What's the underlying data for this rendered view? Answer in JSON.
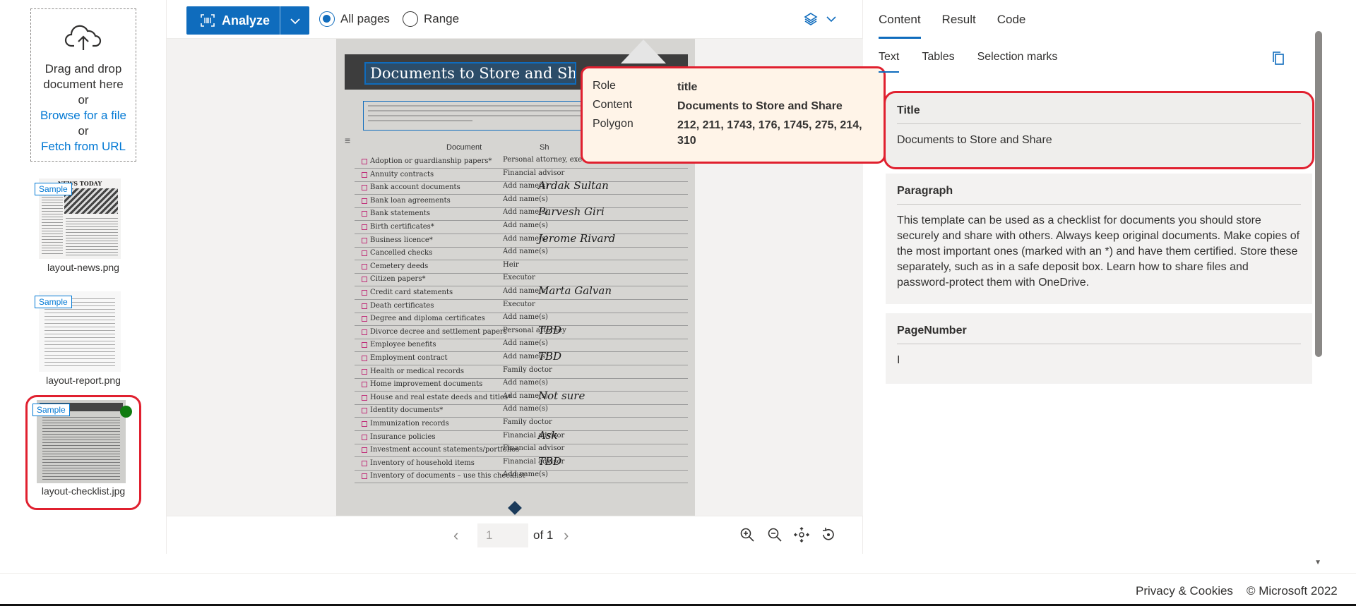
{
  "left": {
    "dropzone": {
      "line1": "Drag and drop",
      "line2": "document here",
      "or1": "or",
      "browse": "Browse for a file",
      "or2": "or",
      "fetch": "Fetch from URL"
    },
    "samples": [
      {
        "badge": "Sample",
        "name": "layout-news.png",
        "headline": "NEWS TODAY"
      },
      {
        "badge": "Sample",
        "name": "layout-report.png"
      },
      {
        "badge": "Sample",
        "name": "layout-checklist.jpg"
      }
    ]
  },
  "toolbar": {
    "analyze": "Analyze",
    "all_pages": "All pages",
    "range": "Range"
  },
  "document": {
    "title": "Documents to Store and Share",
    "intro_lines": [
      "This template can be used as a checklist for documents you should store securely",
      "others. Always keep original documents. Make copies of the most important ones",
      "as *) and have them certified. Store these separately, such as in a safe deposit box.",
      "share files and password-protect them with OneDrive."
    ],
    "col_document": "Document",
    "col_share": "Sh",
    "rows": [
      {
        "doc": "Adoption or guardianship papers*",
        "share": "Personal attorney, exec",
        "hand": ""
      },
      {
        "doc": "Annuity contracts",
        "share": "Financial advisor",
        "hand": ""
      },
      {
        "doc": "Bank account documents",
        "share": "Add name(s)",
        "hand": "Ardak Sultan"
      },
      {
        "doc": "Bank loan agreements",
        "share": "Add name(s)",
        "hand": ""
      },
      {
        "doc": "Bank statements",
        "share": "Add name(s)",
        "hand": "Parvesh Giri"
      },
      {
        "doc": "Birth certificates*",
        "share": "Add name(s)",
        "hand": ""
      },
      {
        "doc": "Business licence*",
        "share": "Add name(s)",
        "hand": "Jerome Rivard"
      },
      {
        "doc": "Cancelled checks",
        "share": "Add name(s)",
        "hand": ""
      },
      {
        "doc": "Cemetery deeds",
        "share": "Heir",
        "hand": ""
      },
      {
        "doc": "Citizen papers*",
        "share": "Executor",
        "hand": ""
      },
      {
        "doc": "Credit card statements",
        "share": "Add name(s)",
        "hand": "Marta Galvan"
      },
      {
        "doc": "Death certificates",
        "share": "Executor",
        "hand": ""
      },
      {
        "doc": "Degree and diploma certificates",
        "share": "Add name(s)",
        "hand": ""
      },
      {
        "doc": "Divorce decree and settlement papers",
        "share": "Personal attorney",
        "hand": "TBD"
      },
      {
        "doc": "Employee benefits",
        "share": "Add name(s)",
        "hand": ""
      },
      {
        "doc": "Employment contract",
        "share": "Add name(s)",
        "hand": "TBD"
      },
      {
        "doc": "Health or medical records",
        "share": "Family doctor",
        "hand": ""
      },
      {
        "doc": "Home improvement documents",
        "share": "Add name(s)",
        "hand": ""
      },
      {
        "doc": "House and real estate deeds and titles*",
        "share": "Add name(s)",
        "hand": "Not sure"
      },
      {
        "doc": "Identity documents*",
        "share": "Add name(s)",
        "hand": ""
      },
      {
        "doc": "Immunization records",
        "share": "Family doctor",
        "hand": ""
      },
      {
        "doc": "Insurance policies",
        "share": "Financial advisor",
        "hand": "Ask"
      },
      {
        "doc": "Investment account statements/portfolios",
        "share": "Financial advisor",
        "hand": ""
      },
      {
        "doc": "Inventory of household items",
        "share": "Financial advisor",
        "hand": "TBD"
      },
      {
        "doc": "Inventory of documents – use this checklist",
        "share": "Add name(s)",
        "hand": ""
      }
    ]
  },
  "pager": {
    "page": "1",
    "of": "of 1"
  },
  "tooltip": {
    "role_k": "Role",
    "role_v": "title",
    "content_k": "Content",
    "content_v": "Documents to Store and Share",
    "polygon_k": "Polygon",
    "polygon_v": "212, 211, 1743, 176, 1745, 275, 214, 310"
  },
  "right": {
    "tabs": [
      "Content",
      "Result",
      "Code"
    ],
    "subtabs": [
      "Text",
      "Tables",
      "Selection marks"
    ],
    "cards": [
      {
        "heading": "Title",
        "body": "Documents to Store and Share"
      },
      {
        "heading": "Paragraph",
        "body": "This template can be used as a checklist for documents you should store securely and share with others. Always keep original documents. Make copies of the most important ones (marked with an *) and have them certified. Store these separately, such as in a safe deposit box. Learn how to share files and password-protect them with OneDrive."
      },
      {
        "heading": "PageNumber",
        "body": "I"
      }
    ]
  },
  "footer": {
    "privacy": "Privacy & Cookies",
    "copyright": "© Microsoft 2022"
  },
  "colors": {
    "accent": "#0f6cbd",
    "highlight": "#e0202f",
    "status": "#107c10"
  }
}
